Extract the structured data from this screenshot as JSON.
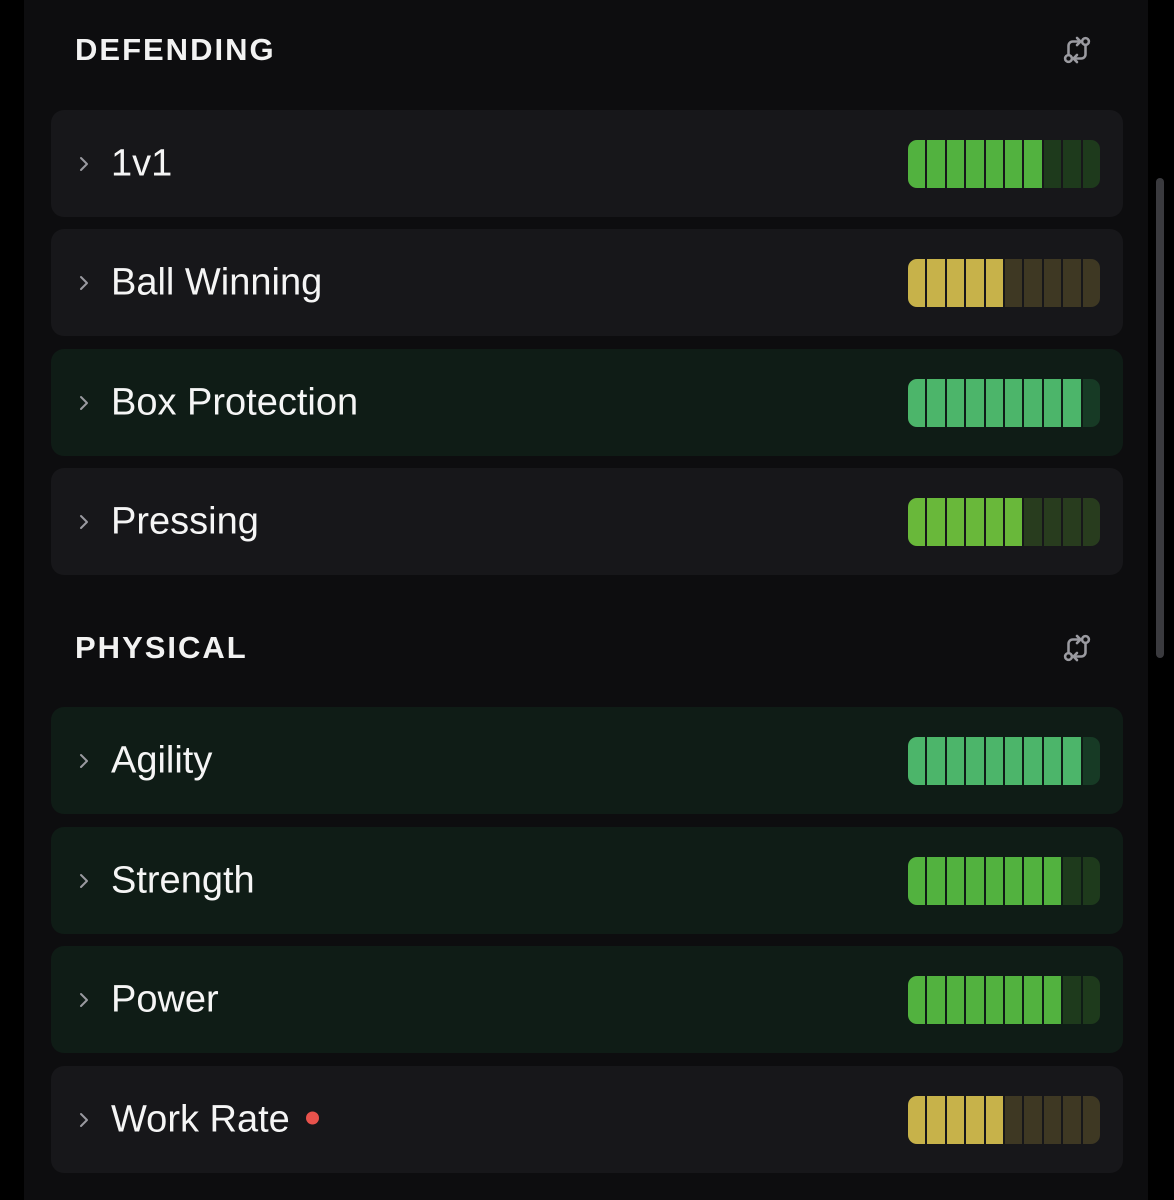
{
  "sections": [
    {
      "title": "DEFENDING",
      "rows": [
        {
          "label": "1v1",
          "level": 7,
          "max": 10,
          "tier": "green",
          "highlight": false,
          "alert": false
        },
        {
          "label": "Ball Winning",
          "level": 5,
          "max": 10,
          "tier": "yellow",
          "highlight": false,
          "alert": false
        },
        {
          "label": "Box Protection",
          "level": 9,
          "max": 10,
          "tier": "bright-green",
          "highlight": true,
          "alert": false
        },
        {
          "label": "Pressing",
          "level": 6,
          "max": 10,
          "tier": "lime",
          "highlight": false,
          "alert": false
        }
      ]
    },
    {
      "title": "PHYSICAL",
      "rows": [
        {
          "label": "Agility",
          "level": 9,
          "max": 10,
          "tier": "bright-green",
          "highlight": true,
          "alert": false
        },
        {
          "label": "Strength",
          "level": 8,
          "max": 10,
          "tier": "green",
          "highlight": true,
          "alert": false
        },
        {
          "label": "Power",
          "level": 8,
          "max": 10,
          "tier": "green",
          "highlight": true,
          "alert": false
        },
        {
          "label": "Work Rate",
          "level": 5,
          "max": 10,
          "tier": "yellow",
          "highlight": false,
          "alert": true
        }
      ]
    }
  ],
  "colors": {
    "green": {
      "on": "#52b23f",
      "off": "#1e3a1c"
    },
    "bright-green": {
      "on": "#4cb56a",
      "off": "#173a25"
    },
    "lime": {
      "on": "#69b83a",
      "off": "#283c1e"
    },
    "yellow": {
      "on": "#c7b24a",
      "off": "#3e3823"
    }
  },
  "icons": {
    "chevron": "chevron-right-icon",
    "swap": "compare-swap-icon",
    "alert": "alert-dot-icon"
  }
}
